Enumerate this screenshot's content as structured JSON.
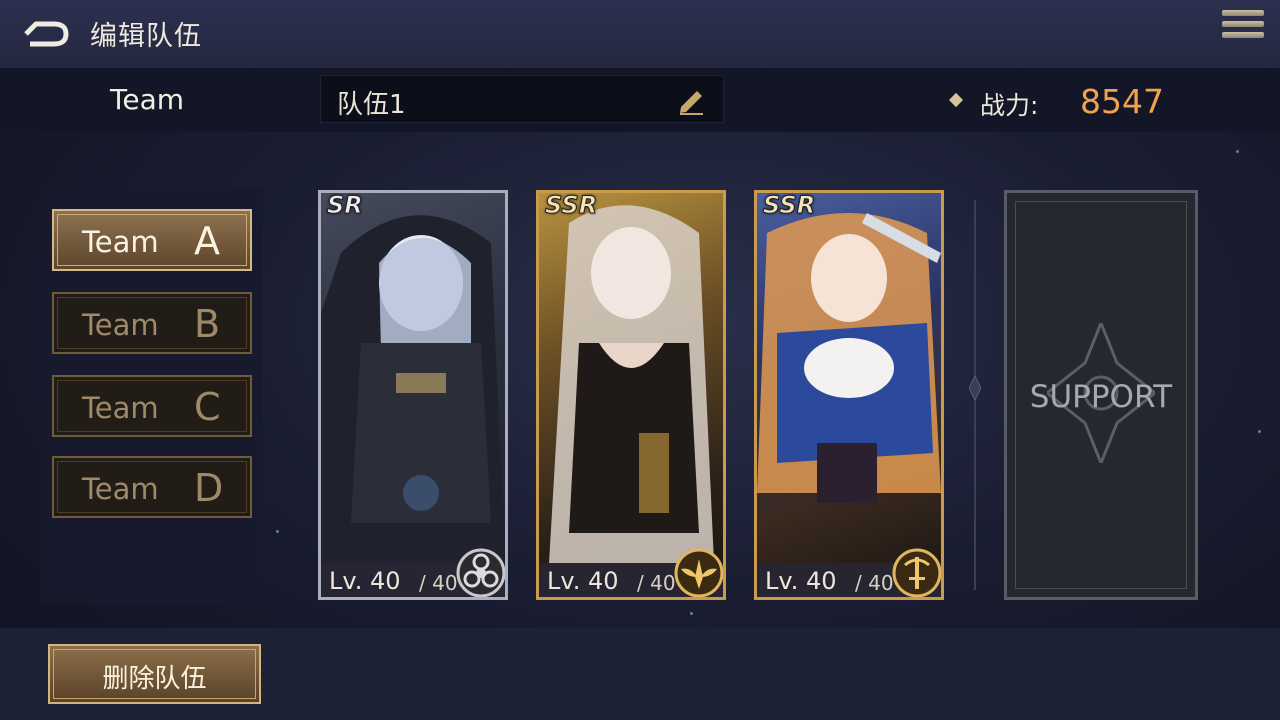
{
  "header": {
    "title": "编辑队伍",
    "back_icon": "back-arrow-icon",
    "menu_icon": "hamburger-menu-icon"
  },
  "team_bar": {
    "label": "Team",
    "team_name": "队伍1",
    "power_label": "战力:",
    "power_value": "8547"
  },
  "team_tabs": [
    {
      "word": "Team",
      "letter": "A",
      "active": true
    },
    {
      "word": "Team",
      "letter": "B",
      "active": false
    },
    {
      "word": "Team",
      "letter": "C",
      "active": false
    },
    {
      "word": "Team",
      "letter": "D",
      "active": false
    }
  ],
  "characters": [
    {
      "rarity": "SR",
      "level": "Lv. 40",
      "max_level": "/ 40",
      "class_icon": "hazard-class-icon",
      "frame_color": "#a9aebb"
    },
    {
      "rarity": "SSR",
      "level": "Lv. 40",
      "max_level": "/ 40",
      "class_icon": "winged-class-icon",
      "frame_color": "#c99b4c"
    },
    {
      "rarity": "SSR",
      "level": "Lv. 40",
      "max_level": "/ 40",
      "class_icon": "sword-class-icon",
      "frame_color": "#c99b4c"
    }
  ],
  "support": {
    "label": "SUPPORT"
  },
  "footer": {
    "delete_label": "删除队伍"
  },
  "colors": {
    "accent_gold": "#d1b47e",
    "power_orange": "#f2a24a"
  }
}
